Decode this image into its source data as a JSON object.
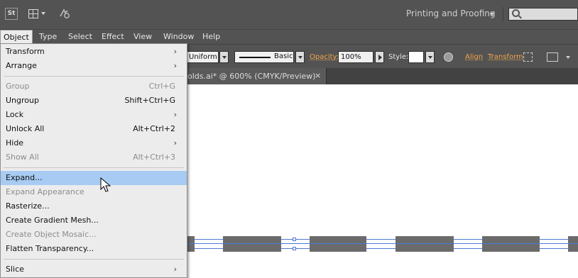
{
  "appbar": {
    "st_label": "St",
    "workspace": "Printing and Proofing"
  },
  "menubar": {
    "items": [
      "Object",
      "Type",
      "Select",
      "Effect",
      "View",
      "Window",
      "Help"
    ]
  },
  "controlbar": {
    "uniform": "Uniform",
    "basic": "Basic",
    "opacity_label": "Opacity:",
    "opacity_value": "100%",
    "style_label": "Style:",
    "align": "Align",
    "transform": "Transform"
  },
  "document_tab": {
    "title": "olds.ai* @ 600% (CMYK/Preview)",
    "close": "×"
  },
  "object_menu": {
    "items": [
      {
        "label": "Transform",
        "shortcut": "",
        "submenu": true,
        "enabled": true
      },
      {
        "label": "Arrange",
        "shortcut": "",
        "submenu": true,
        "enabled": true
      },
      {
        "label": "Group",
        "shortcut": "Ctrl+G",
        "submenu": false,
        "enabled": false
      },
      {
        "label": "Ungroup",
        "shortcut": "Shift+Ctrl+G",
        "submenu": false,
        "enabled": true
      },
      {
        "label": "Lock",
        "shortcut": "",
        "submenu": true,
        "enabled": true
      },
      {
        "label": "Unlock All",
        "shortcut": "Alt+Ctrl+2",
        "submenu": false,
        "enabled": true
      },
      {
        "label": "Hide",
        "shortcut": "",
        "submenu": true,
        "enabled": true
      },
      {
        "label": "Show All",
        "shortcut": "Alt+Ctrl+3",
        "submenu": false,
        "enabled": false
      },
      {
        "label": "Expand...",
        "shortcut": "",
        "submenu": false,
        "enabled": true
      },
      {
        "label": "Expand Appearance",
        "shortcut": "",
        "submenu": false,
        "enabled": false
      },
      {
        "label": "Rasterize...",
        "shortcut": "",
        "submenu": false,
        "enabled": true
      },
      {
        "label": "Create Gradient Mesh...",
        "shortcut": "",
        "submenu": false,
        "enabled": true
      },
      {
        "label": "Create Object Mosaic...",
        "shortcut": "",
        "submenu": false,
        "enabled": false
      },
      {
        "label": "Flatten Transparency...",
        "shortcut": "",
        "submenu": false,
        "enabled": true
      },
      {
        "label": "Slice",
        "shortcut": "",
        "submenu": true,
        "enabled": true
      }
    ],
    "highlighted": "Expand...",
    "submenu_glyph": "›"
  },
  "icons": [
    "st-icon",
    "workspace-layout-icon",
    "sync-settings-icon",
    "search-icon",
    "globe-icon",
    "isolate-icon",
    "more-options-icon",
    "cursor-icon"
  ],
  "colors": {
    "ui_dark": "#535353",
    "menu_bg": "#ececec",
    "highlight": "#a7cbf2",
    "selection": "#4c77d6",
    "control_link": "#f2a64a"
  }
}
